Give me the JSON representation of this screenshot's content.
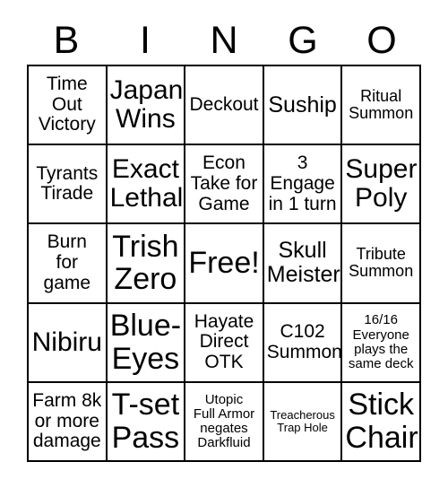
{
  "card": {
    "header_letters": [
      "B",
      "I",
      "N",
      "G",
      "O"
    ],
    "rows": 5,
    "columns": 5,
    "border_color": "#000000",
    "background_color": "#ffffff",
    "text_color": "#000000",
    "free_space_index": 12
  },
  "cells": [
    {
      "text": "Time\nOut\nVictory",
      "size": "md",
      "free": false
    },
    {
      "text": "Japan\nWins",
      "size": "xl",
      "free": false
    },
    {
      "text": "Deckout",
      "size": "md",
      "free": false
    },
    {
      "text": "Suship",
      "size": "lg",
      "free": false
    },
    {
      "text": "Ritual\nSummon",
      "size": "sm",
      "free": false
    },
    {
      "text": "Tyrants\nTirade",
      "size": "md",
      "free": false
    },
    {
      "text": "Exact\nLethal",
      "size": "xl",
      "free": false
    },
    {
      "text": "Econ\nTake for\nGame",
      "size": "md",
      "free": false
    },
    {
      "text": "3\nEngage\nin 1 turn",
      "size": "md",
      "free": false
    },
    {
      "text": "Super\nPoly",
      "size": "xl",
      "free": false
    },
    {
      "text": "Burn\nfor\ngame",
      "size": "md",
      "free": false
    },
    {
      "text": "Trish\nZero",
      "size": "xxl",
      "free": false
    },
    {
      "text": "Free!",
      "size": "xxl",
      "free": true
    },
    {
      "text": "Skull\nMeister",
      "size": "lg",
      "free": false
    },
    {
      "text": "Tribute\nSummon",
      "size": "sm",
      "free": false
    },
    {
      "text": "Nibiru",
      "size": "xl",
      "free": false
    },
    {
      "text": "Blue-\nEyes",
      "size": "xxl",
      "free": false
    },
    {
      "text": "Hayate\nDirect\nOTK",
      "size": "md",
      "free": false
    },
    {
      "text": "C102\nSummon",
      "size": "md",
      "free": false
    },
    {
      "text": "16/16\nEveryone\nplays the\nsame deck",
      "size": "xs",
      "free": false
    },
    {
      "text": "Farm 8k\nor more\ndamage",
      "size": "md",
      "free": false
    },
    {
      "text": "T-set\nPass",
      "size": "xxl",
      "free": false
    },
    {
      "text": "Utopic\nFull Armor\nnegates\nDarkfluid",
      "size": "xs",
      "free": false
    },
    {
      "text": "Treacherous\nTrap Hole",
      "size": "xxs",
      "free": false
    },
    {
      "text": "Stick\nChair",
      "size": "xxl",
      "free": false
    }
  ]
}
